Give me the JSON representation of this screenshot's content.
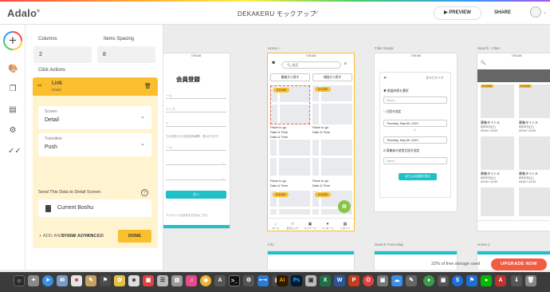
{
  "header": {
    "logo": "Adalo",
    "app_name": "DEKAKERU モックアップ",
    "preview_label": "PREVIEW",
    "share_label": "SHARE"
  },
  "panel": {
    "columns_label": "Columns",
    "columns_value": "2",
    "spacing_label": "Items Spacing",
    "spacing_value": "8",
    "click_actions_label": "Click Actions",
    "action": {
      "title": "Link",
      "subtitle": "Detail",
      "screen_label": "Screen",
      "screen_value": "Detail",
      "transition_label": "Transition",
      "transition_value": "Push",
      "send_data_label": "Send This Data to Detail Screen",
      "current_label": "Current Boshu",
      "show_advanced": "SHOW ADVANCED",
      "done": "DONE"
    },
    "add_action": "+ ADD ANOTHER ACTION"
  },
  "canvas": {
    "login": {
      "status_time": "7:55 AM",
      "title": "会員登録",
      "field1": "ーム",
      "field2": "ドレス",
      "field3": "ド",
      "hint": "でのお知らせや役割定情報等、表示されます",
      "field4": "ーム",
      "button": "次へ",
      "footer": "アカウントを自作ちの方はこちら"
    },
    "home": {
      "label": "Home",
      "status_time": "7:55 AM",
      "search": "検索",
      "btn1": "最後から探す",
      "btn2": "地図から探す",
      "pill": "¥ 5,000",
      "place": "Place to go",
      "date": "Date & Time",
      "nav": [
        "ホーム",
        "お気に入り",
        "マイページ",
        "メッセージ",
        "ミタイペ"
      ]
    },
    "filter": {
      "label": "Filter Modal",
      "status_time": "7:55 AM",
      "clear": "すべてクリア",
      "pref_label": "都道府県を選択",
      "pref_placeholder": "Select...",
      "date_label": "日程を指定",
      "date1": "Thursday, May 4th, 2019",
      "date2": "Thursday, May 4th, 2019",
      "lang_label": "募集者の使用言語を指定",
      "lang_placeholder": "Select...",
      "submit": "絞り込み結果を表示"
    },
    "search": {
      "label": "Search · Filter",
      "status_time": "7:55 AM",
      "price1": "¥ 5,000",
      "price2": "¥ 5,000",
      "title1": "募集タイトル",
      "title2": "募集タイトル",
      "date1": "8月30日(土)",
      "time1": "09:00〜14:30",
      "date2": "8月30日(土)",
      "time2": "09:00〜14:30"
    },
    "bottom_labels": [
      "Info",
      "Search From Map",
      "Home 2"
    ]
  },
  "storage": {
    "text": "22% of free storage used",
    "upgrade": "UPGRADE NOW"
  },
  "colors": {
    "accent": "#fbbf2e",
    "teal": "#1fc0c8",
    "upgrade": "#f25c43"
  }
}
